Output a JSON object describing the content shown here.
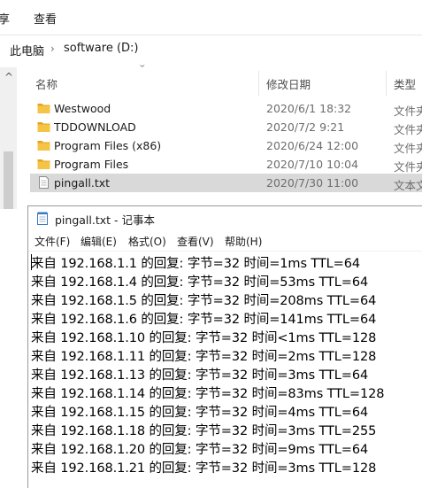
{
  "ribbon": {
    "tab_share": "享",
    "tab_view": "查看"
  },
  "address": {
    "this_pc": "此电脑",
    "separator": "›",
    "drive": "software (D:)"
  },
  "columns": {
    "name": "名称",
    "date": "修改日期",
    "type": "类型"
  },
  "files": [
    {
      "name": "Westwood",
      "date": "2020/6/1 18:32",
      "type": "文件夹",
      "icon": "folder-icon"
    },
    {
      "name": "TDDOWNLOAD",
      "date": "2020/7/2 9:21",
      "type": "文件夹",
      "icon": "folder-icon"
    },
    {
      "name": "Program Files (x86)",
      "date": "2020/6/24 12:00",
      "type": "文件夹",
      "icon": "folder-icon"
    },
    {
      "name": "Program Files",
      "date": "2020/7/10 10:04",
      "type": "文件夹",
      "icon": "folder-icon"
    },
    {
      "name": "pingall.txt",
      "date": "2020/7/30 11:00",
      "type": "文本文档",
      "icon": "text-file-icon",
      "selected": true
    }
  ],
  "notepad": {
    "title": "pingall.txt - 记事本",
    "menu": {
      "file": "文件(F)",
      "edit": "编辑(E)",
      "format": "格式(O)",
      "view": "查看(V)",
      "help": "帮助(H)"
    },
    "lines": [
      "来自 192.168.1.1 的回复: 字节=32 时间=1ms TTL=64",
      "来自 192.168.1.4 的回复: 字节=32 时间=53ms TTL=64",
      "来自 192.168.1.5 的回复: 字节=32 时间=208ms TTL=64",
      "来自 192.168.1.6 的回复: 字节=32 时间=141ms TTL=64",
      "来自 192.168.1.10 的回复: 字节=32 时间<1ms TTL=128",
      "来自 192.168.1.11 的回复: 字节=32 时间=2ms TTL=128",
      "来自 192.168.1.13 的回复: 字节=32 时间=3ms TTL=64",
      "来自 192.168.1.14 的回复: 字节=32 时间=83ms TTL=128",
      "来自 192.168.1.15 的回复: 字节=32 时间=4ms TTL=64",
      "来自 192.168.1.18 的回复: 字节=32 时间=3ms TTL=255",
      "来自 192.168.1.20 的回复: 字节=32 时间=9ms TTL=64",
      "来自 192.168.1.21 的回复: 字节=32 时间=3ms TTL=128"
    ]
  },
  "colors": {
    "folder": "#f6c445",
    "folder_dark": "#e3a520",
    "selection": "#d9d9d9"
  }
}
